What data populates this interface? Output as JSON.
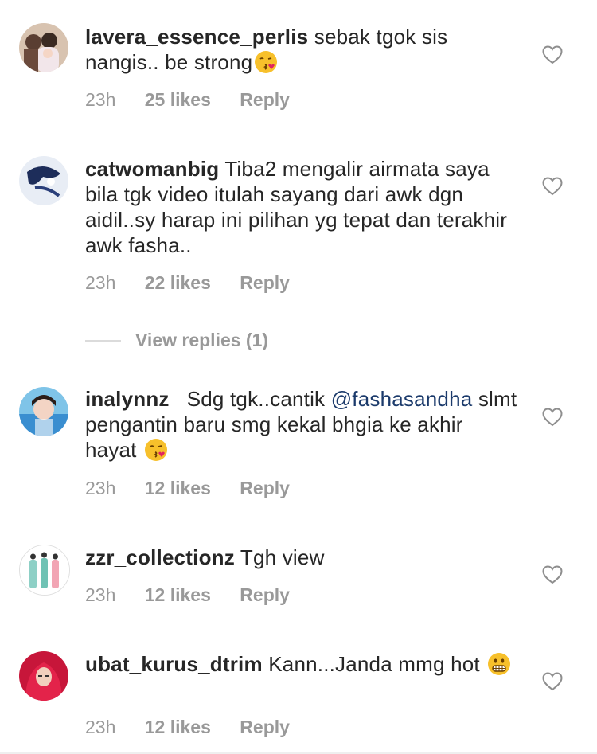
{
  "comments": [
    {
      "username": "lavera_essence_perlis",
      "text": "sebak tgok sis nangis.. be strong",
      "emoji": "kissing-face-emoji",
      "time": "23h",
      "likes": "25 likes",
      "reply": "Reply"
    },
    {
      "username": "catwomanbig",
      "text": "Tiba2 mengalir airmata saya bila tgk video itulah sayang dari awk dgn aidil..sy harap ini pilihan yg tepat dan terakhir awk fasha..",
      "time": "23h",
      "likes": "22 likes",
      "reply": "Reply",
      "view_replies": "View replies (1)"
    },
    {
      "username": "inalynnz_",
      "text_before": "Sdg tgk..cantik",
      "mention": "@fashasandha",
      "text_after": "slmt pengantin baru smg kekal bhgia ke akhir hayat",
      "emoji": "kissing-face-emoji",
      "time": "23h",
      "likes": "12 likes",
      "reply": "Reply"
    },
    {
      "username": "zzr_collectionz",
      "text": "Tgh view",
      "time": "23h",
      "likes": "12 likes",
      "reply": "Reply"
    },
    {
      "username": "ubat_kurus_dtrim",
      "text": "Kann...Janda mmg hot",
      "emoji": "grimacing-face-emoji",
      "time": "23h",
      "likes": "12 likes",
      "reply": "Reply"
    }
  ],
  "colors": {
    "text": "#262626",
    "meta": "#999999",
    "mention": "#1b3a6b",
    "divider": "#dbdbdb"
  },
  "icons": [
    "heart-outline-icon",
    "kissing-face-emoji",
    "grimacing-face-emoji"
  ]
}
